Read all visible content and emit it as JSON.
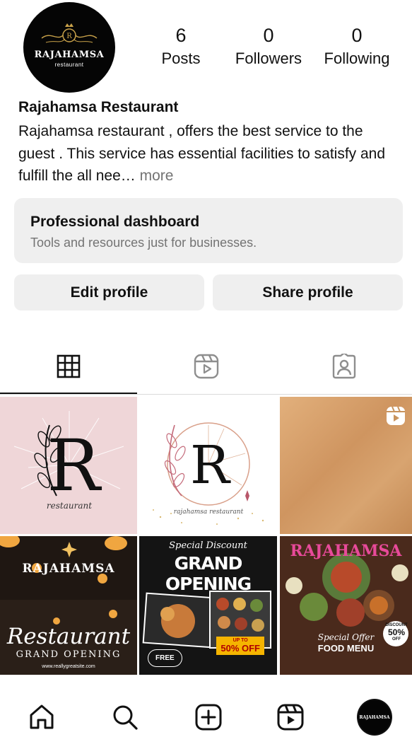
{
  "profile": {
    "avatar_brand": "RAJAHAMSA",
    "avatar_sub": "restaurant",
    "name": "Rajahamsa Restaurant",
    "bio": "Rajahamsa restaurant , offers the best service to the guest . This service has essential facilities to satisfy and fulfill the all nee…",
    "bio_more": "more"
  },
  "stats": {
    "posts": {
      "value": "6",
      "label": "Posts"
    },
    "followers": {
      "value": "0",
      "label": "Followers"
    },
    "following": {
      "value": "0",
      "label": "Following"
    }
  },
  "dashboard": {
    "title": "Professional dashboard",
    "subtitle": "Tools and resources just for businesses."
  },
  "buttons": {
    "edit": "Edit profile",
    "share": "Share profile"
  },
  "tabs": [
    {
      "icon": "grid-icon",
      "active": true
    },
    {
      "icon": "reels-icon",
      "active": false
    },
    {
      "icon": "tagged-icon",
      "active": false
    }
  ],
  "posts": {
    "p1": {
      "caption": "restaurant"
    },
    "p2": {
      "letter": "R",
      "caption": "rajahamsa restaurant"
    },
    "p4": {
      "title": "RAJAHAMSA",
      "script": "Restaurant",
      "tag": "GRAND OPENING",
      "site": "www.reallygreatsite.com"
    },
    "p5": {
      "tagline": "Special Discount",
      "title": "GRAND OPENING",
      "offer_up": "UP TO",
      "offer": "50% OFF",
      "free": "FREE"
    },
    "p6": {
      "title": "RAJAHAMSA",
      "special": "Special Offer",
      "menu": "FOOD MENU",
      "discount": "DISCOUNT",
      "discount_value": "50%",
      "discount_off": "OFF"
    }
  },
  "bottom_nav": [
    {
      "icon": "home-icon"
    },
    {
      "icon": "search-icon"
    },
    {
      "icon": "create-icon"
    },
    {
      "icon": "reels-icon"
    },
    {
      "icon": "profile-avatar"
    }
  ],
  "nav_avatar_text": "RAJAHAMSA"
}
